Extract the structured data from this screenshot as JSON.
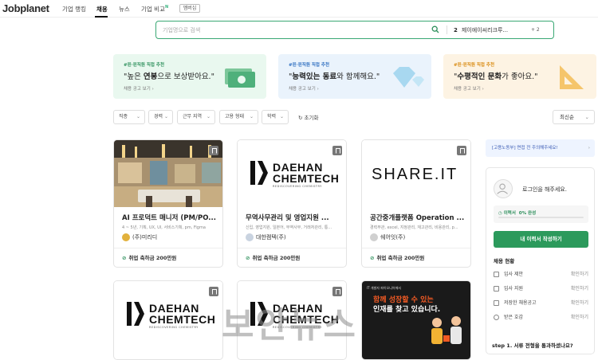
{
  "nav": {
    "logo": "Jobplanet",
    "items": [
      "기업 랭킹",
      "채용",
      "뉴스",
      "기업 비교"
    ],
    "new_badge": "N",
    "button": "멤버십"
  },
  "search": {
    "placeholder": "기업명으로 검색",
    "recent_count": "2",
    "recent_company": "제이에이씨리크루...",
    "recent_more": "+ 2"
  },
  "banners": [
    {
      "tag": "#핀·핀직원 직접 추천",
      "pre": "\"높은 ",
      "bold": "연봉",
      "post": "으로 보상받아요.\"",
      "link": "채용 공고 보기",
      "bg": "#e9f8ef",
      "tag_color": "#2c8f5b"
    },
    {
      "tag": "#핀·핀직원 직접 추천",
      "pre": "\"",
      "bold": "능력있는 동료",
      "post": "와 함께해요.\"",
      "link": "채용 공고 보기",
      "bg": "#eaf3fc",
      "tag_color": "#2f6fc0"
    },
    {
      "tag": "#핀·핀직원 직접 추천",
      "pre": "\"",
      "bold": "수평적인 문화",
      "post": "가 좋아요.\"",
      "link": "채용 공고 보기",
      "bg": "#fdf3e3",
      "tag_color": "#d8890f"
    }
  ],
  "filters": [
    "직종",
    "경력",
    "근무 지역",
    "고용 형태",
    "학력"
  ],
  "reset_label": "초기화",
  "sort_label": "최신순",
  "cards": [
    {
      "title": "AI 프로덕트 매니저 (PM/PO...",
      "meta": "4 ~ 5년, 기획, UX, UI, 서비스기획, pm, Figma",
      "company": "(주)미리디",
      "bonus": "취업 축하금 200만원",
      "logo_color": "#e2b13c"
    },
    {
      "title": "무역사무관리 및 영업지원 ...",
      "meta": "신입, 영업지원, 일본어, 무역사무, 거래처관리, 통...",
      "company": "대한켐텍(주)",
      "bonus": "취업 축하금 200만원",
      "logo_color": "#c9d3e0"
    },
    {
      "title": "공간중개플랫폼 Operation ...",
      "meta": "경력무관, excel, 지정관리, 재고관리, 비용관리, p...",
      "company": "쉐어잇(주)",
      "bonus": "취업 축하금 200만원",
      "logo_color": "#d0d0d0"
    }
  ],
  "daehan_logo": {
    "line1": "DAEHAN",
    "line2": "CHEMTECH",
    "line3": "REDISCOVERING CHEMISTRY"
  },
  "shareit_logo": "SHARE.IT",
  "ad": {
    "small": "IT 개발자 파이오니어에서",
    "line1": "함께 성장할 수 있는",
    "line2": "인재를 찾고 있습니다."
  },
  "side": {
    "alert": "[고용노동부] 면접 전 주의해주세요!",
    "login": "로그인을 해주세요.",
    "resume_label": "이력서",
    "resume_pct": "0% 완성",
    "resume_progress": 0.0,
    "cta": "내 이력서 작성하기",
    "status_title": "채용 현황",
    "status": [
      {
        "label": "입사 제안",
        "action": "확인하기"
      },
      {
        "label": "입사 지원",
        "action": "확인하기"
      },
      {
        "label": "저장한 채용공고",
        "action": "확인하기"
      },
      {
        "label": "받은 호감",
        "action": "확인하기"
      }
    ],
    "step": "step 1. 서류 전형을 통과하셨나요?"
  },
  "watermark": "보안뉴스"
}
